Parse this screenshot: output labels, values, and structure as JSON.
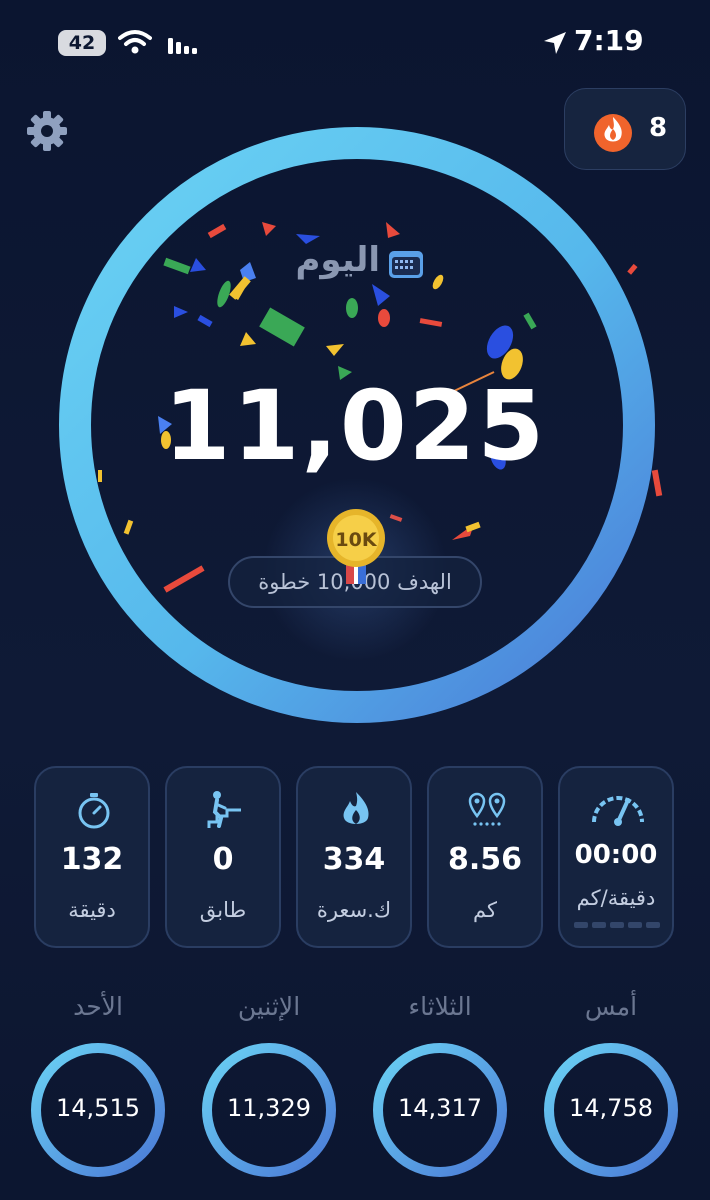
{
  "status_bar": {
    "battery": "42",
    "time": "7:19"
  },
  "streak": {
    "count": "8"
  },
  "today": {
    "label": "اليوم",
    "steps": "11,025",
    "goal_text": "الهدف 10,000 خطوة",
    "badge": "10K",
    "goal_progress": 1.0
  },
  "stats": [
    {
      "value": "132",
      "unit": "دقيقة",
      "icon": "stopwatch-icon"
    },
    {
      "value": "0",
      "unit": "طابق",
      "icon": "stairs-climber-icon"
    },
    {
      "value": "334",
      "unit": "ك.سعرة",
      "icon": "flame-icon"
    },
    {
      "value": "8.56",
      "unit": "كم",
      "icon": "route-pins-icon"
    },
    {
      "value": "00:00",
      "unit": "دقيقة/كم",
      "icon": "speedometer-icon"
    }
  ],
  "history": [
    {
      "day": "الأحد",
      "steps": "14,515"
    },
    {
      "day": "الإثنين",
      "steps": "11,329"
    },
    {
      "day": "الثلاثاء",
      "steps": "14,317"
    },
    {
      "day": "أمس",
      "steps": "14,758"
    }
  ],
  "colors": {
    "background": "#0d1831",
    "ring_light": "#5cc8ee",
    "ring_dark": "#4a7fd8",
    "card_bg": "#15233f",
    "card_border": "#2a3d62",
    "accent_icon": "#78c4f2",
    "streak_flame": "#f26a2e"
  }
}
